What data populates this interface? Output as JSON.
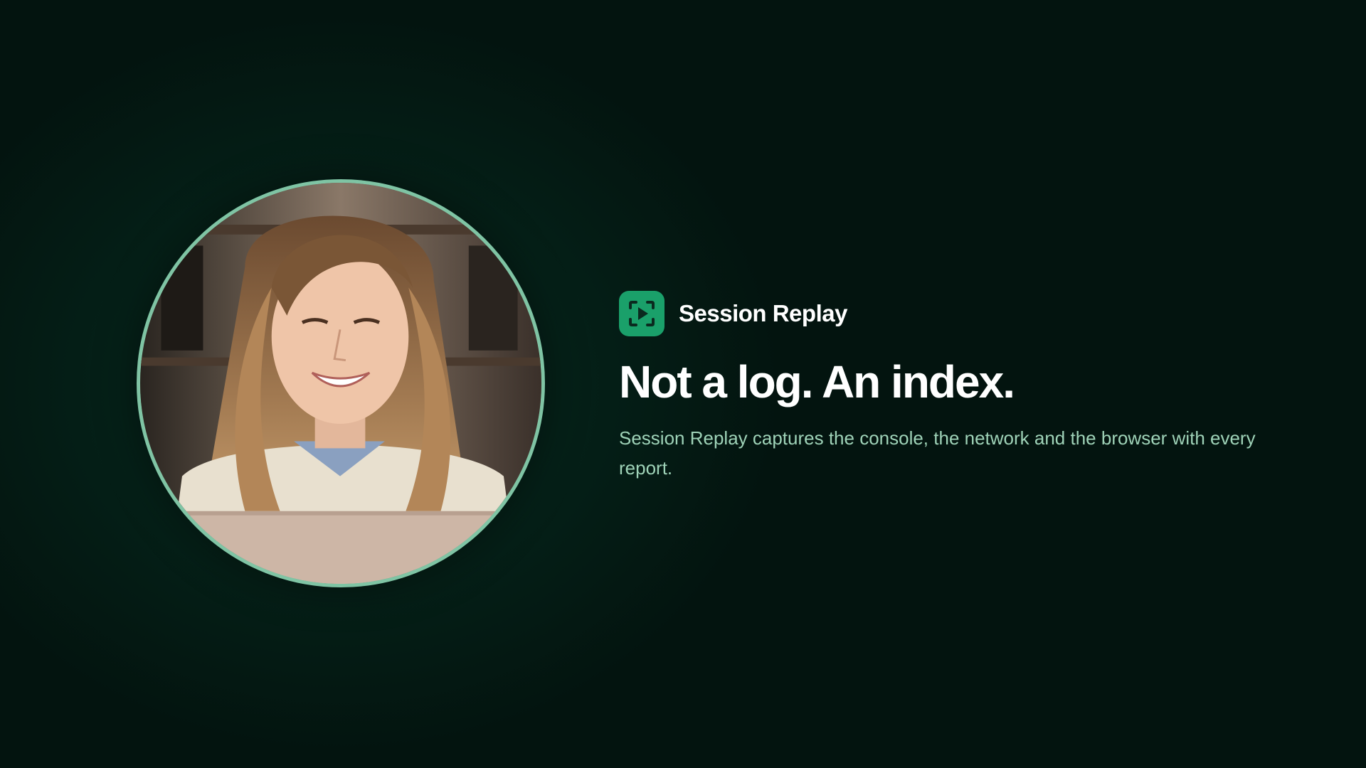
{
  "hero": {
    "photo_alt": "Smiling woman with long wavy hair working at a laptop",
    "product_name": "Session Replay",
    "product_icon": "play-in-frame-icon",
    "headline": "Not a log. An index.",
    "description": "Session Replay captures the console, the network and the browser with every report."
  },
  "colors": {
    "background": "#03140f",
    "accent": "#1aa06a",
    "ring": "#7fc4a4",
    "body_text": "#9fd3b8"
  }
}
